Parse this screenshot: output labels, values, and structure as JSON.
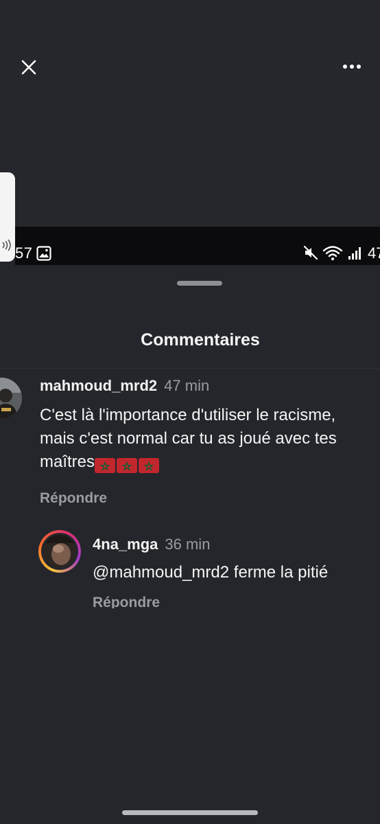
{
  "status_bar": {
    "time": "57",
    "battery": "47",
    "icons": [
      "gallery-icon",
      "mute-icon",
      "wifi-icon",
      "signal-icon"
    ]
  },
  "top_bar": {
    "icons": [
      "close-icon",
      "more-options-icon"
    ]
  },
  "sheet": {
    "title": "Commentaires"
  },
  "comments": [
    {
      "username": "mahmoud_mrd2",
      "time": "47 min",
      "text": "C'est là l'importance d'utiliser le racisme, mais c'est normal car tu as joué avec tes maîtres",
      "emoji": [
        "morocco-flag",
        "morocco-flag",
        "morocco-flag"
      ],
      "reply_label": "Répondre"
    },
    {
      "username": "4na_mga",
      "time": "36 min",
      "text": "@mahmoud_mrd2 ferme la pitié",
      "reply_label": "Répondre"
    }
  ],
  "colors": {
    "background": "#24262b",
    "muted_text": "#9a9ca1",
    "flag_red": "#c1272d",
    "flag_green": "#006233"
  }
}
